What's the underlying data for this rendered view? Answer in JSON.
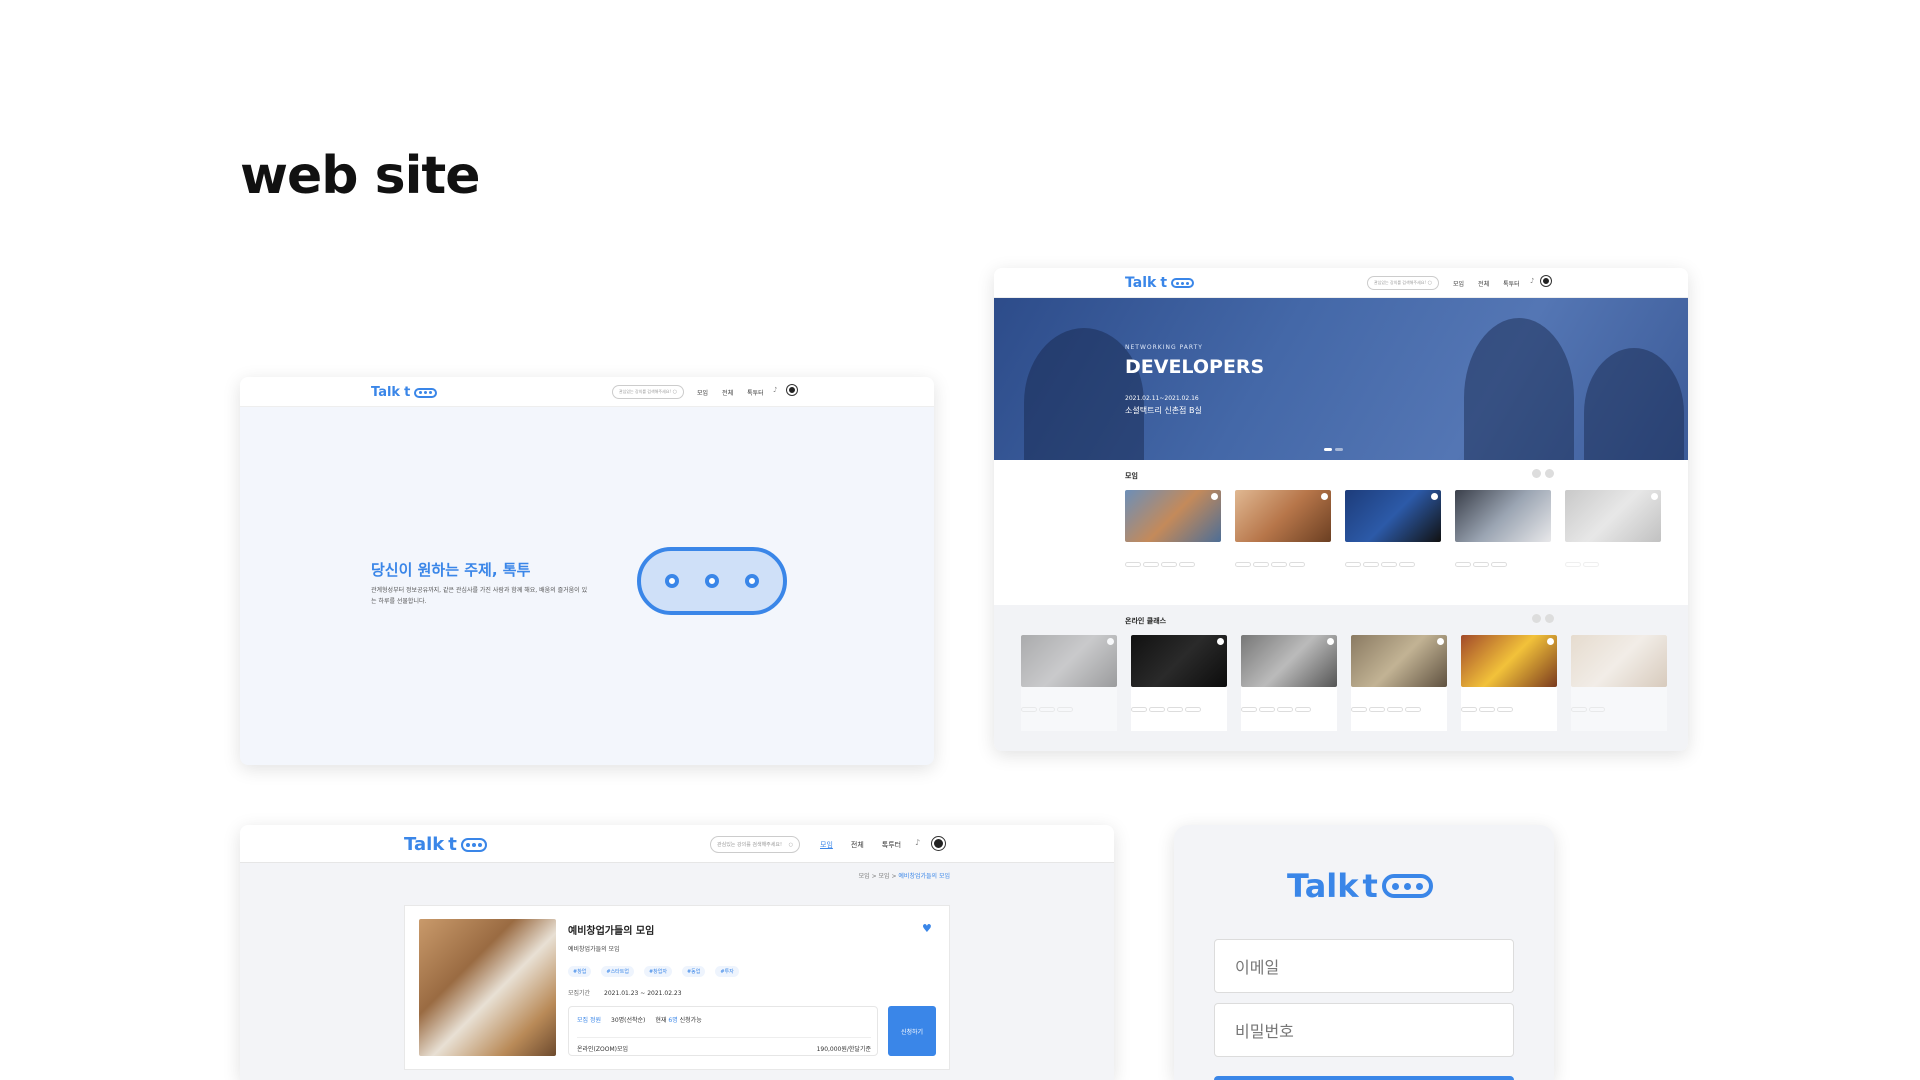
{
  "page": {
    "title": "web site"
  },
  "brand": {
    "name": "Talk",
    "accent": "#3a86e8"
  },
  "nav": {
    "search_placeholder": "관심있는 강의를 검색해주세요!",
    "menu": [
      "모임",
      "전체",
      "톡투터"
    ]
  },
  "hero": {
    "title": "당신이 원하는 주제, 톡투",
    "description": "관계형성부터 정보공유까지, 같은 관심사를 가진 사람과 함께 해요, 배움의 즐거움이 있는 하루를 선물합니다."
  },
  "banner": {
    "kicker": "NETWORKING PARTY",
    "headline": "DEVELOPERS",
    "date": "2021.02.11~2021.02.16",
    "place": "소셜택트리 신촌점 B실"
  },
  "sections": {
    "meetups": "모임",
    "online_class": "온라인 클래스"
  },
  "detail": {
    "breadcrumb": [
      "모임",
      "모임",
      "예비창업가들의 모임"
    ],
    "title": "예비창업가들의 모임",
    "subtitle": "예비창업가들의 모임",
    "tags": [
      "#창업",
      "#스타트업",
      "#창업자",
      "#동업",
      "#투자"
    ],
    "period_label": "모집기간",
    "period": "2021.01.23 ~ 2021.02.23",
    "capacity_label": "모집 정원",
    "capacity": "30명(선착순)",
    "remaining_prefix": "현재",
    "remaining_count": "6명",
    "remaining_suffix": "신청가능",
    "mode": "온라인(ZOOM)모임",
    "price": "190,000원/한달기준",
    "apply_label": "신청하기"
  },
  "login": {
    "email_placeholder": "이메일",
    "password_placeholder": "비밀번호"
  }
}
